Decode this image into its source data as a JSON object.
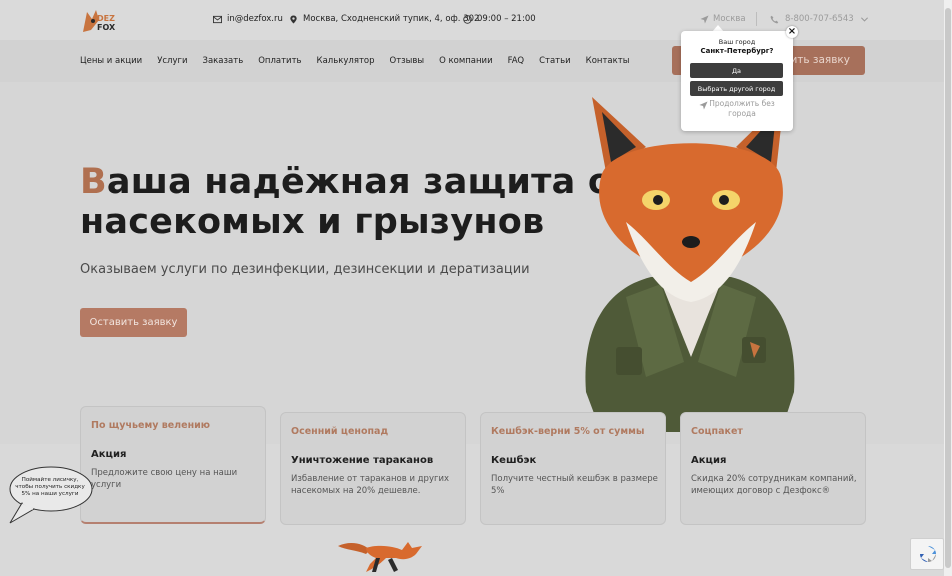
{
  "header": {
    "email": "in@dezfox.ru",
    "address": "Москва, Сходненский тупик, 4, оф. 302",
    "hours": "09:00 – 21:00",
    "city": "Москва",
    "phone": "8-800-707-6543"
  },
  "logo": {
    "line1": "DEZ",
    "line2": "FOX"
  },
  "nav": {
    "items": [
      "Цены и акции",
      "Услуги",
      "Заказать",
      "Оплатить",
      "Калькулятор",
      "Отзывы",
      "О компании",
      "FAQ",
      "Статьи",
      "Контакты"
    ],
    "cta": "Оставить заявку"
  },
  "hero": {
    "title_first_letter": "В",
    "title_rest_line1": "аша надёжная защита от",
    "title_line2": "насекомых и грызунов",
    "subtitle": "Оказываем услуги по дезинфекции, дезинсекции и дератизации",
    "button": "Оставить заявку"
  },
  "cards": [
    {
      "tag": "По щучьему велению",
      "title": "Акция",
      "text": "Предложите свою цену на наши услуги"
    },
    {
      "tag": "Осенний ценопад",
      "title": "Уничтожение тараканов",
      "text": "Избавление от тараканов и других насекомых на 20% дешевле."
    },
    {
      "tag": "Кешбэк-верни 5% от суммы",
      "title": "Кешбэк",
      "text": "Получите честный кешбэк в размере 5%"
    },
    {
      "tag": "Соцпакет",
      "title": "Акция",
      "text": "Скидка 20% сотрудникам компаний, имеющих договор с Дезфокс®"
    }
  ],
  "bubble": {
    "text": "Поймайте лисичку, чтобы получить скидку 5% на наши услуги"
  },
  "popup": {
    "question": "Ваш город",
    "city": "Санкт-Петербург?",
    "yes": "Да",
    "other": "Выбрать другой город",
    "continue": "Продолжить без города",
    "close": "×"
  },
  "colors": {
    "accent": "#b07050",
    "button": "#b57a64",
    "popup_button": "#3d3d3d"
  }
}
